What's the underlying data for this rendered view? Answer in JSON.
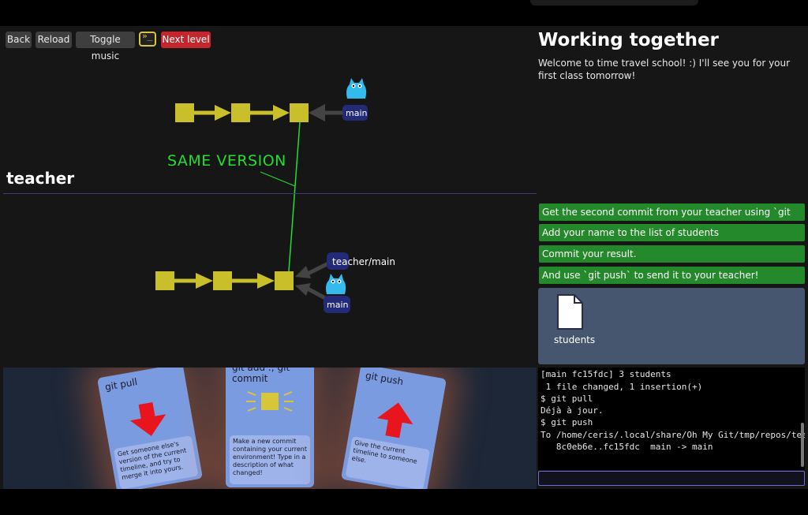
{
  "toolbar": {
    "back": "Back",
    "reload": "Reload",
    "toggle_music": "Toggle music",
    "terminal_glyph": "»_",
    "next_level": "Next level"
  },
  "graph": {
    "teacher_label": "teacher",
    "annotation": "SAME VERSION",
    "top_refs": [
      "main"
    ],
    "bottom_refs": [
      "teacher/main",
      "main"
    ]
  },
  "cards": [
    {
      "title": "git pull",
      "desc": "Get someone else's version of the current timeline, and try to merge it into yours.",
      "icon": "down-arrow-icon"
    },
    {
      "title": "git add .; git commit",
      "desc": "Make a new commit containing your current environment! Type in a description of what changed!",
      "icon": "commit-square-icon"
    },
    {
      "title": "git push",
      "desc": "Give the current timeline to someone else.",
      "icon": "up-arrow-icon"
    }
  ],
  "level": {
    "title": "Working together",
    "description": "Welcome to time travel school! :) I'll see you for your first class tomorrow!"
  },
  "goals": [
    "Get the second commit from your teacher using `git pull`.",
    "Add your name to the list of students",
    "Commit your result.",
    "And use `git push` to send it to your teacher!"
  ],
  "files": [
    {
      "name": "students",
      "icon": "file-icon"
    }
  ],
  "terminal": {
    "lines": [
      "[main fc15fdc] 3 students",
      " 1 file changed, 1 insertion(+)",
      "$ git pull",
      "Déjà à jour.",
      "$ git push",
      "To /home/ceris/.local/share/Oh My Git/tmp/repos/teacher/",
      "   8c0eb6e..fc15fdc  main -> main"
    ],
    "input_value": ""
  },
  "colors": {
    "commit": "#c8bf2a",
    "goal": "#24892a",
    "next_level": "#c4262e",
    "annotation": "#22dd33",
    "ref_badge": "#232a78",
    "avatar": "#33bbee"
  }
}
